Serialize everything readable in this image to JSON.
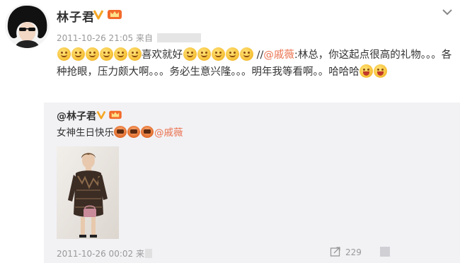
{
  "post": {
    "username": "林子君",
    "timestamp": "2011-10-26 21:05",
    "source_prefix": "来自",
    "text_part1": "喜欢就好",
    "text_sep": " //",
    "mention": "@戚薇",
    "text_part2": ":林总，你这起点很高的礼物。。。各种抢眼，压力颇大啊。。。务必生意兴隆。。。明年我等看啊。。哈哈哈",
    "icons": {
      "verified": "v-badge-icon",
      "vip": "crown-icon",
      "menu": "chevron-down-icon"
    }
  },
  "repost": {
    "username": "@林子君",
    "text": "女神生日快乐",
    "mention": "@戚薇",
    "timestamp": "2011-10-26 00:02",
    "source_prefix": "来",
    "share_count": "229",
    "icons": {
      "share": "share-icon",
      "cake": "cake-emoji-icon"
    }
  },
  "colors": {
    "mention": "#eb7350",
    "meta": "#999999",
    "repost_bg": "#f2f2f5",
    "badge": "#f5a623"
  }
}
